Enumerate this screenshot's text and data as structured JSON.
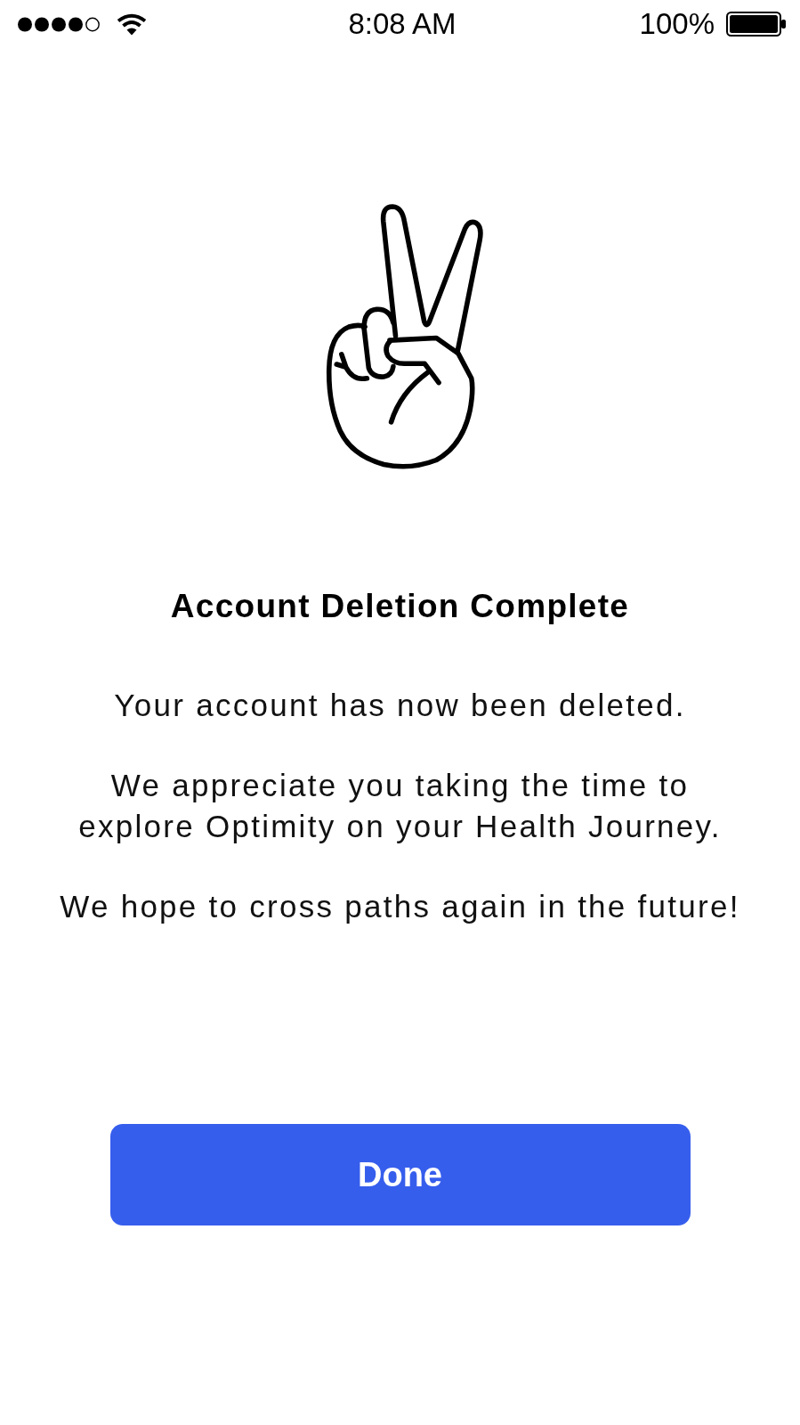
{
  "status_bar": {
    "time": "8:08 AM",
    "battery": "100%"
  },
  "title": "Account Deletion Complete",
  "paragraphs": [
    {
      "lines": [
        "Your account has now been deleted."
      ]
    },
    {
      "lines": [
        "We appreciate you taking the time to",
        "explore Optimity on your Health Journey."
      ]
    },
    {
      "lines": [
        "We hope to cross paths again in the future!"
      ]
    }
  ],
  "button": {
    "label": "Done"
  }
}
